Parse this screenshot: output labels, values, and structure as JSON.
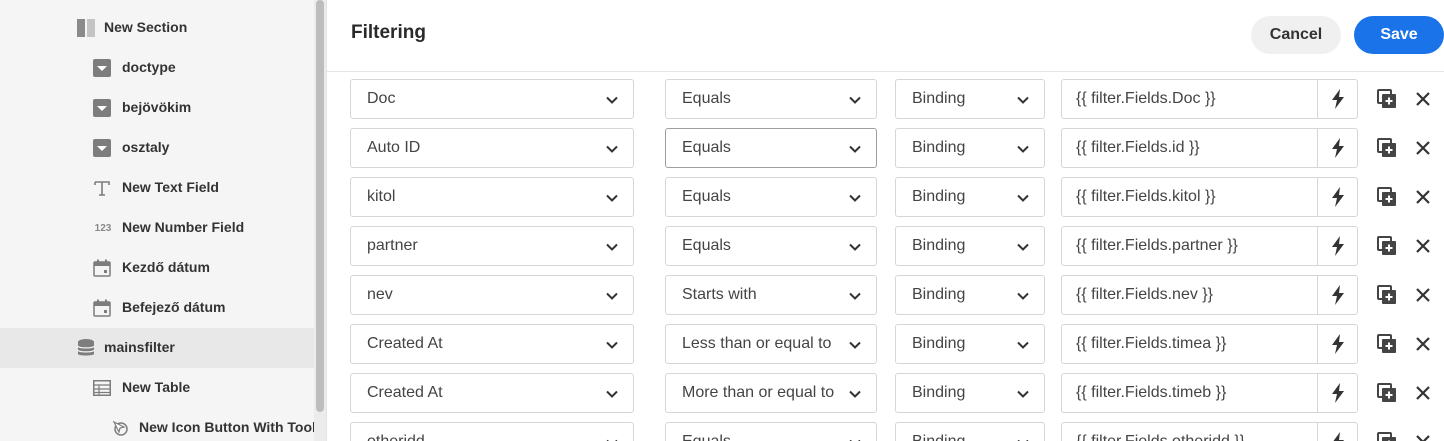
{
  "sidebar": {
    "items": [
      {
        "label": "New Section",
        "icon": "section-icon"
      },
      {
        "label": "doctype",
        "icon": "dropdown-icon"
      },
      {
        "label": "bejövökim",
        "icon": "dropdown-icon"
      },
      {
        "label": "osztaly",
        "icon": "dropdown-icon"
      },
      {
        "label": "New Text Field",
        "icon": "text-field-icon"
      },
      {
        "label": "New Number Field",
        "icon": "number-field-icon",
        "icon_text": "123"
      },
      {
        "label": "Kezdő dátum",
        "icon": "calendar-icon"
      },
      {
        "label": "Befejező dátum",
        "icon": "calendar-icon"
      },
      {
        "label": "mainsfilter",
        "icon": "database-icon",
        "selected": true
      },
      {
        "label": "New Table",
        "icon": "table-icon"
      },
      {
        "label": "New Icon Button With Toolt",
        "icon": "icon-button-icon"
      }
    ]
  },
  "header": {
    "title": "Filtering",
    "cancel_label": "Cancel",
    "save_label": "Save"
  },
  "filters": [
    {
      "field": "Doc",
      "operator": "Equals",
      "type": "Binding",
      "value": "{{ filter.Fields.Doc }}"
    },
    {
      "field": "Auto ID",
      "operator": "Equals",
      "type": "Binding",
      "value": "{{ filter.Fields.id }}",
      "operator_focused": true
    },
    {
      "field": "kitol",
      "operator": "Equals",
      "type": "Binding",
      "value": "{{ filter.Fields.kitol }}"
    },
    {
      "field": "partner",
      "operator": "Equals",
      "type": "Binding",
      "value": "{{ filter.Fields.partner }}"
    },
    {
      "field": "nev",
      "operator": "Starts with",
      "type": "Binding",
      "value": "{{ filter.Fields.nev }}"
    },
    {
      "field": "Created At",
      "operator": "Less than or equal to",
      "type": "Binding",
      "value": "{{ filter.Fields.timea }}"
    },
    {
      "field": "Created At",
      "operator": "More than or equal to",
      "type": "Binding",
      "value": "{{ filter.Fields.timeb }}"
    },
    {
      "field": "otheridd",
      "operator": "Equals",
      "type": "Binding",
      "value": "{{ filter.Fields.otheridd }}"
    }
  ],
  "colors": {
    "accent": "#1a73e8",
    "sidebar_bg": "#f5f5f5",
    "selected_bg": "#e8e8e8"
  }
}
